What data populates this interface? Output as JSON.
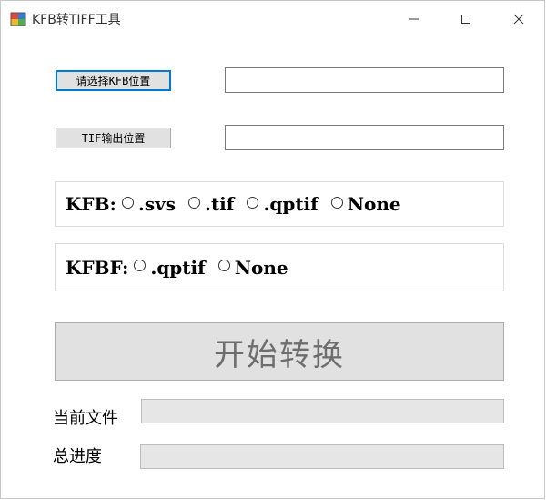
{
  "window": {
    "title": "KFB转TIFF工具"
  },
  "controls": {
    "select_kfb_label": "请选择KFB位置",
    "tif_output_label": "TIF输出位置",
    "kfb_path_value": "",
    "tif_path_value": ""
  },
  "kfb_group": {
    "label": "KFB:",
    "options": [
      ".svs",
      ".tif",
      ".qptif",
      "None"
    ]
  },
  "kfbf_group": {
    "label": "KFBF:",
    "options": [
      ".qptif",
      "None"
    ]
  },
  "convert": {
    "label": "开始转换"
  },
  "progress": {
    "current_file_label": "当前文件",
    "total_label": "总进度",
    "current_file_value": 0,
    "total_value": 0
  },
  "colors": {
    "focus_border": "#0078d7",
    "button_bg": "#e1e1e1",
    "progress_fill": "#06b025"
  },
  "icons": {
    "app": "app-icon",
    "minimize": "minimize-icon",
    "maximize": "maximize-icon",
    "close": "close-icon"
  }
}
